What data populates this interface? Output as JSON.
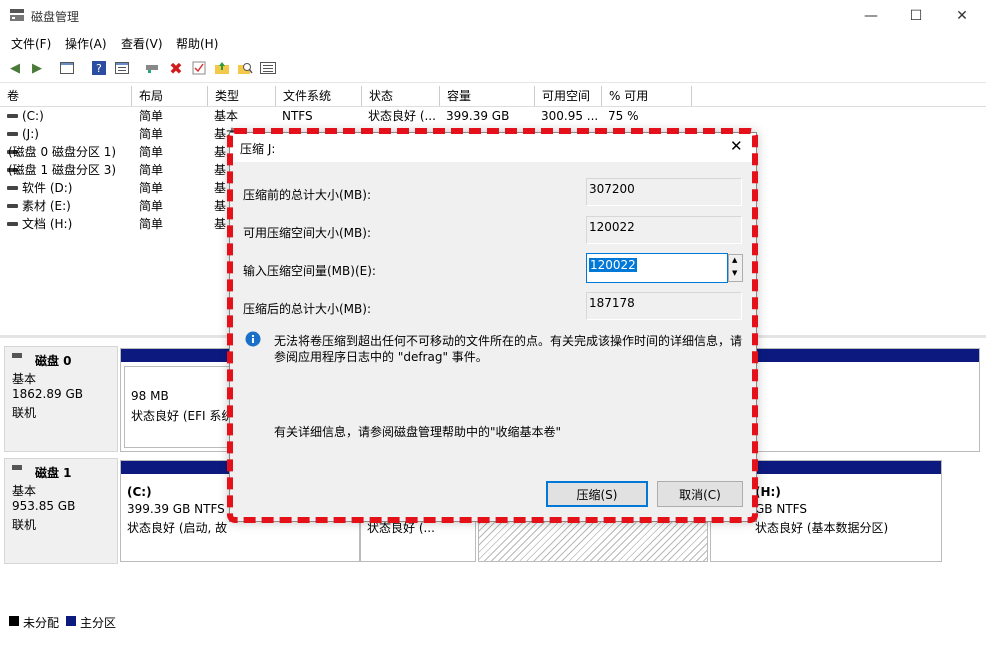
{
  "window": {
    "title": "磁盘管理",
    "minimize_label": "—",
    "maximize_label": "☐",
    "close_label": "✕"
  },
  "menu": [
    "文件(F)",
    "操作(A)",
    "查看(V)",
    "帮助(H)"
  ],
  "toolbar_icons": [
    "back-icon",
    "forward-icon",
    "console-view-icon",
    "help-icon",
    "properties-view-icon",
    "connect-icon",
    "delete-icon",
    "checklist-icon",
    "folder-up-icon",
    "search-icon",
    "list-icon"
  ],
  "columns": [
    "卷",
    "布局",
    "类型",
    "文件系统",
    "状态",
    "容量",
    "可用空间",
    "% 可用"
  ],
  "volumes": [
    {
      "name": "(C:)",
      "layout": "简单",
      "type": "基本",
      "fs": "NTFS",
      "status": "状态良好 (...",
      "capacity": "399.39 GB",
      "free": "300.95 ...",
      "pct": "75 %"
    },
    {
      "name": "(J:)",
      "layout": "简单",
      "type": "基本",
      "fs": "",
      "status": "",
      "capacity": "",
      "free": "",
      "pct": ""
    },
    {
      "name": "(磁盘 0 磁盘分区 1)",
      "layout": "简单",
      "type": "基",
      "fs": "",
      "status": "",
      "capacity": "",
      "free": "",
      "pct": ""
    },
    {
      "name": "(磁盘 1 磁盘分区 3)",
      "layout": "简单",
      "type": "基",
      "fs": "",
      "status": "",
      "capacity": "",
      "free": "",
      "pct": ""
    },
    {
      "name": "软件 (D:)",
      "layout": "简单",
      "type": "基",
      "fs": "",
      "status": "",
      "capacity": "",
      "free": "",
      "pct": ""
    },
    {
      "name": "素材 (E:)",
      "layout": "简单",
      "type": "基",
      "fs": "",
      "status": "",
      "capacity": "",
      "free": "",
      "pct": ""
    },
    {
      "name": "文档 (H:)",
      "layout": "简单",
      "type": "基",
      "fs": "",
      "status": "",
      "capacity": "",
      "free": "",
      "pct": ""
    }
  ],
  "disks": [
    {
      "name": "磁盘 0",
      "type": "基本",
      "size": "1862.89 GB",
      "state": "联机",
      "partition1": {
        "line1": "98 MB",
        "line2": "状态良好 (EFI 系统"
      }
    },
    {
      "name": "磁盘 1",
      "type": "基本",
      "size": "953.85 GB",
      "state": "联机",
      "partition_c": {
        "name": "(C:)",
        "line1": "399.39 GB NTFS",
        "line2": "状态良好 (启动, 故"
      },
      "partition_mid": {
        "line2": "状态良好 (..."
      },
      "partition_right": {
        "name": "(H:)",
        "line1": "GB NTFS",
        "line2": "状态良好 (基本数据分区)"
      }
    }
  ],
  "legend": [
    {
      "label": "未分配",
      "color": "#000000"
    },
    {
      "label": "主分区",
      "color": "#0c1a80"
    }
  ],
  "dialog": {
    "title": "压缩 J:",
    "before_label": "压缩前的总计大小(MB):",
    "before_value": "307200",
    "available_label": "可用压缩空间大小(MB):",
    "available_value": "120022",
    "input_label": "输入压缩空间量(MB)(E):",
    "input_value": "120022",
    "after_label": "压缩后的总计大小(MB):",
    "after_value": "187178",
    "info_line1": "无法将卷压缩到超出任何不可移动的文件所在的点。有关完成该操作时间的详细信息，请",
    "info_line2": "参阅应用程序日志中的 \"defrag\" 事件。",
    "help_text": "有关详细信息，请参阅磁盘管理帮助中的\"收缩基本卷\"",
    "shrink_button": "压缩(S)",
    "cancel_button": "取消(C)"
  },
  "colors": {
    "accent": "#0078d7",
    "partition_bar": "#0c1a80",
    "highlight": "#e4111b"
  }
}
